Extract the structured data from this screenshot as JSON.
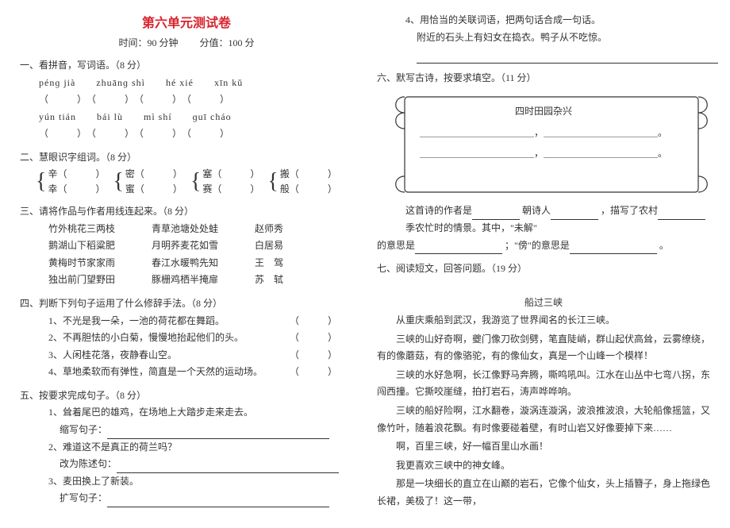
{
  "title": "第六单元测试卷",
  "subtitle_time": "时间：90 分钟",
  "subtitle_score": "分值：100 分",
  "s1": {
    "heading": "一、看拼音，写词语。（8 分）",
    "row1": "pénɡ jià　　zhuānɡ shì　　hé xié　　xīn kǔ",
    "row2": "yún tián　　bái lù　　mì shí　　ɡuī cháo",
    "paren4": "（　　　）　（　　　）　（　　　）　（　　　）"
  },
  "s2": {
    "heading": "二、慧眼识字组词。（8 分）",
    "p1a": "辛（　　　）",
    "p1b": "幸（　　　）",
    "p2a": "密（　　　）",
    "p2b": "蜜（　　　）",
    "p3a": "塞（　　　）",
    "p3b": "赛（　　　）",
    "p4a": "搬（　　　）",
    "p4b": "般（　　　）"
  },
  "s3": {
    "heading": "三、请将作品与作者用线连起来。（8 分）",
    "rows": [
      [
        "竹外桃花三两枝",
        "青草池塘处处蛙",
        "赵师秀"
      ],
      [
        "鹅湖山下稻粱肥",
        "月明荞麦花如雪",
        "白居易"
      ],
      [
        "黄梅时节家家雨",
        "春江水暖鸭先知",
        "王　驾"
      ],
      [
        "独出前门望野田",
        "豚栅鸡栖半掩扉",
        "苏　轼"
      ]
    ]
  },
  "s4": {
    "heading": "四、判断下列句子运用了什么修辞手法。（8 分）",
    "items": [
      "1、不光是我一朵，一池的荷花都在舞蹈。",
      "2、不再胆怯的小白菊，慢慢地抬起他们的头。",
      "3、人闲桂花落，夜静春山空。",
      "4、草地柔软而有弹性，简直是一个天然的运动场。"
    ],
    "paren": "（　　　）"
  },
  "s5": {
    "heading": "五、按要求完成句子。（8 分）",
    "i1": "1、耸着尾巴的雄鸡，在场地上大踏步走来走去。",
    "i1s": "缩写句子：",
    "i2": "2、难道这不是真正的荷兰吗？",
    "i2s": "改为陈述句：",
    "i3": "3、麦田换上了新装。",
    "i3s": "扩写句子：",
    "i4": "4、用恰当的关联词语，把两句话合成一句话。",
    "i4t": "附近的石头上有妇女在捣衣。鸭子从不吃惊。"
  },
  "s6": {
    "heading": "六、默写古诗，按要求填空。（11 分）",
    "poem_title": "四时田园杂兴",
    "line_pair": "＿＿＿＿＿＿＿＿＿＿＿＿，＿＿＿＿＿＿＿＿＿＿＿＿。",
    "desc1a": "这首诗的作者是",
    "desc1b": "朝诗人",
    "desc1c": "，描写了农村",
    "desc1d": "季农忙时的情景。其中，\"未解\"",
    "desc2a": "的意思是",
    "desc2b": "；\"傍\"的意思是",
    "desc2c": "。"
  },
  "s7": {
    "heading": "七、阅读短文，回答问题。（19 分）",
    "ptitle": "船过三峡",
    "p1": "从重庆乘船到武汉，我游览了世界闻名的长江三峡。",
    "p2": "三峡的山好奇啊，夔门像刀砍剑劈，笔直陡峭，群山起伏高耸，云雾缭绕，有的像蘑菇，有的像骆驼，有的像仙女，真是一个山峰一个模样！",
    "p3": "三峡的水好急啊，长江像野马奔腾，嘶鸣吼叫。江水在山丛中七弯八拐，东闯西撞。它撕咬崖缝，拍打岩石，涛声哗哗响。",
    "p4": "三峡的船好险啊，江水翻卷，漩涡连漩涡，波浪推波浪，大轮船像摇篮，又像竹叶，随着浪花飘。有时像要碰着壁，有时山岩又好像要掉下来……",
    "p5": "啊，百里三峡，好一幅百里山水画！",
    "p6": "我更喜欢三峡中的神女峰。",
    "p7": "那是一块细长的直立在山巅的岩石，它像个仙女，头上插簪子，身上拖绿色长裙，美极了！这一带，"
  }
}
